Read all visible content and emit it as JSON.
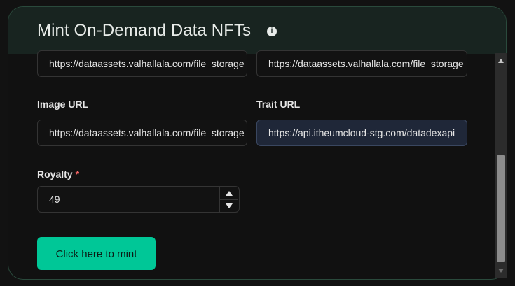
{
  "modal": {
    "title": "Mint On-Demand Data NFTs",
    "info_icon": "info-icon"
  },
  "fields": {
    "top_left_value": "https://dataassets.valhallala.com/file_storage",
    "top_right_value": "https://dataassets.valhallala.com/file_storage",
    "image_url_label": "Image URL",
    "image_url_value": "https://dataassets.valhallala.com/file_storage",
    "trait_url_label": "Trait URL",
    "trait_url_value": "https://api.itheumcloud-stg.com/datadexapi",
    "royalty_label": "Royalty",
    "royalty_required": "*",
    "royalty_value": "49"
  },
  "actions": {
    "mint_label": "Click here to mint"
  },
  "colors": {
    "accent": "#00c797",
    "header_bg": "#182420",
    "required": "#f56565"
  }
}
